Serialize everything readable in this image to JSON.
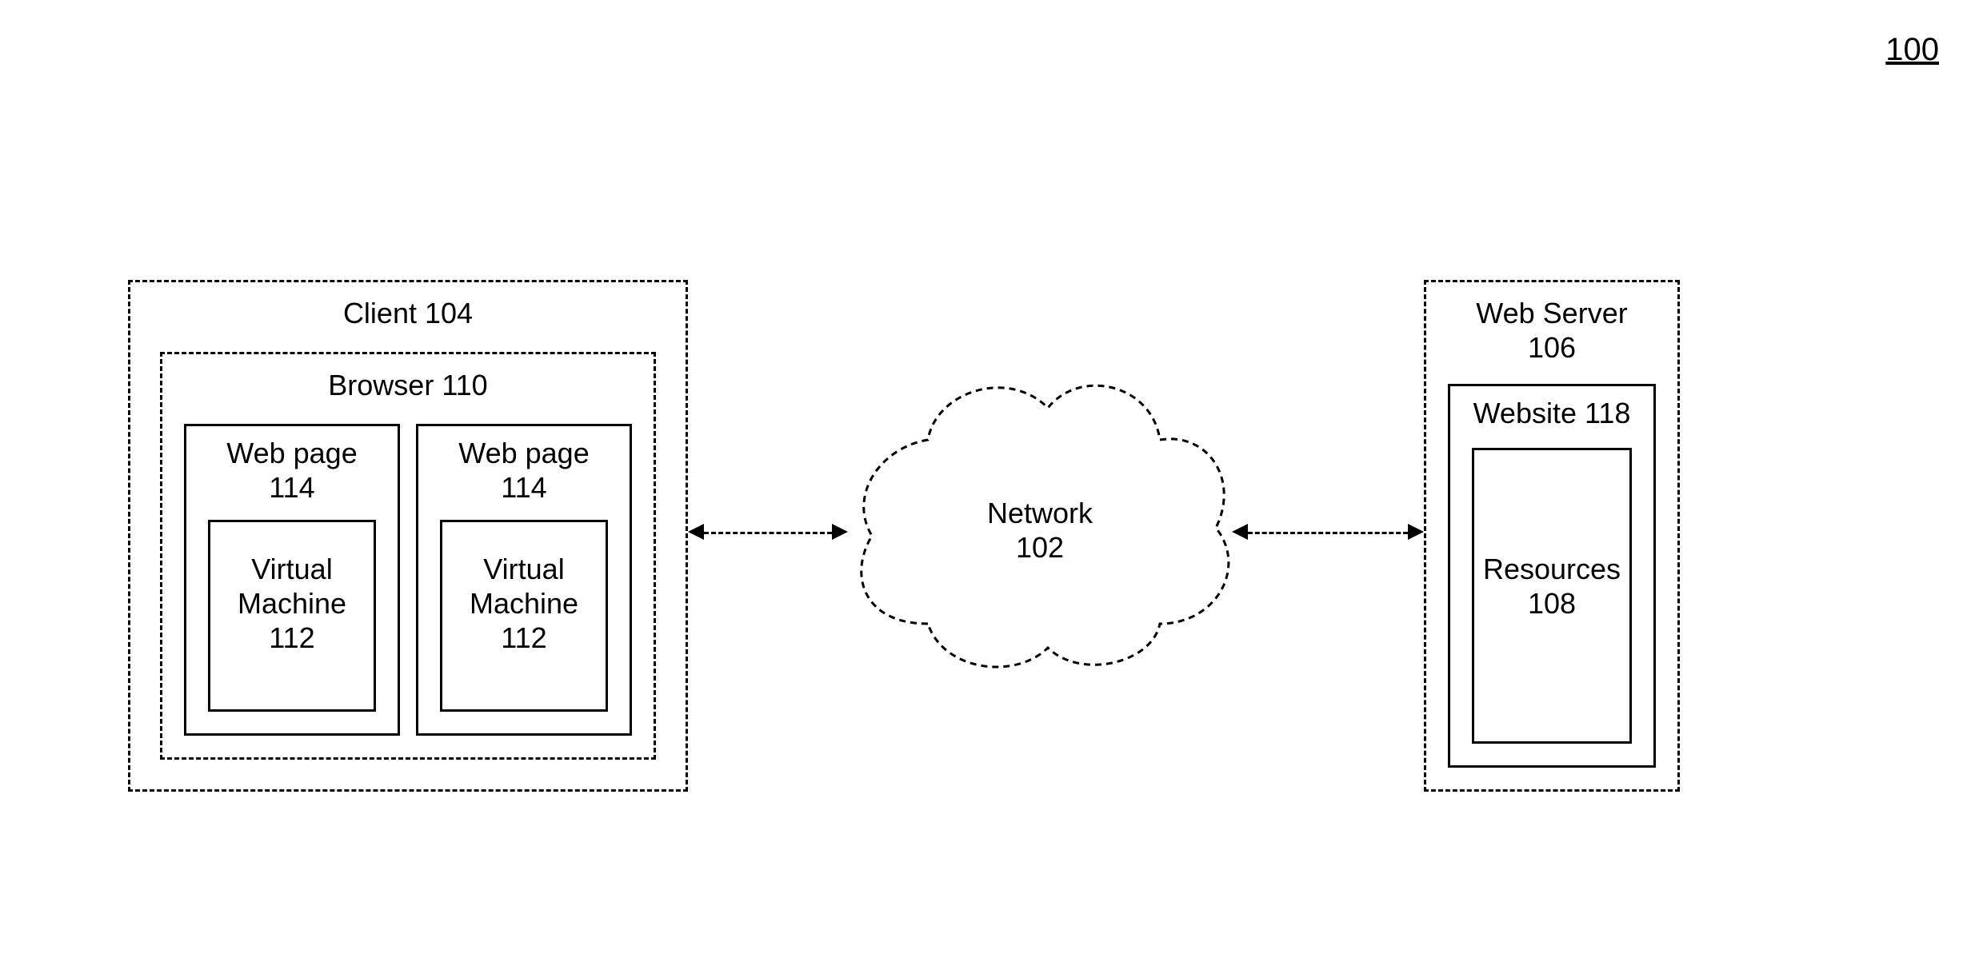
{
  "figure_ref": "100",
  "client": {
    "label": "Client 104",
    "browser": {
      "label": "Browser 110",
      "pages": [
        {
          "label": "Web page\n114",
          "vm": "Virtual\nMachine\n112"
        },
        {
          "label": "Web page\n114",
          "vm": "Virtual\nMachine\n112"
        }
      ]
    }
  },
  "network": {
    "label": "Network\n102"
  },
  "server": {
    "label": "Web Server\n106",
    "website": {
      "label": "Website 118",
      "resources": "Resources\n108"
    }
  }
}
